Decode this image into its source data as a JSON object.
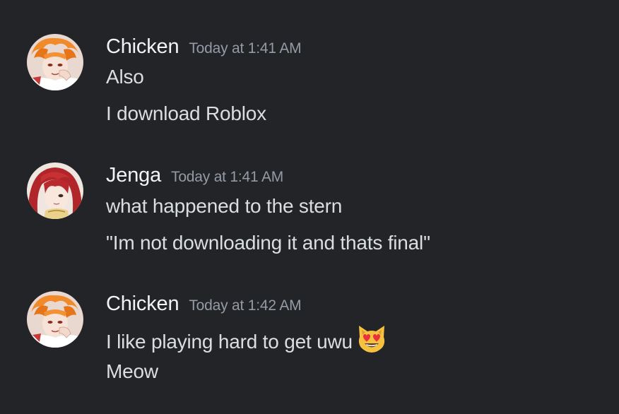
{
  "channel": {
    "groups": [
      {
        "username": "Chicken",
        "timestamp": "Today at 1:41 AM",
        "avatar_icon": "chicken-anime-avatar",
        "lines": [
          "Also",
          "I download Roblox"
        ]
      },
      {
        "username": "Jenga",
        "timestamp": "Today at 1:41 AM",
        "avatar_icon": "jenga-anime-avatar",
        "lines": [
          "what happened to the stern",
          "\"Im not downloading it and thats final\""
        ]
      },
      {
        "username": "Chicken",
        "timestamp": "Today at 1:42 AM",
        "avatar_icon": "chicken-anime-avatar",
        "lines": [
          "I like playing hard to get uwu",
          "Meow"
        ],
        "emoji": "heart-eyes-cat-emoji"
      }
    ]
  },
  "colors": {
    "background": "#232428",
    "username": "#f2f3f5",
    "timestamp": "#949ba4",
    "message_text": "#dbdee1"
  }
}
